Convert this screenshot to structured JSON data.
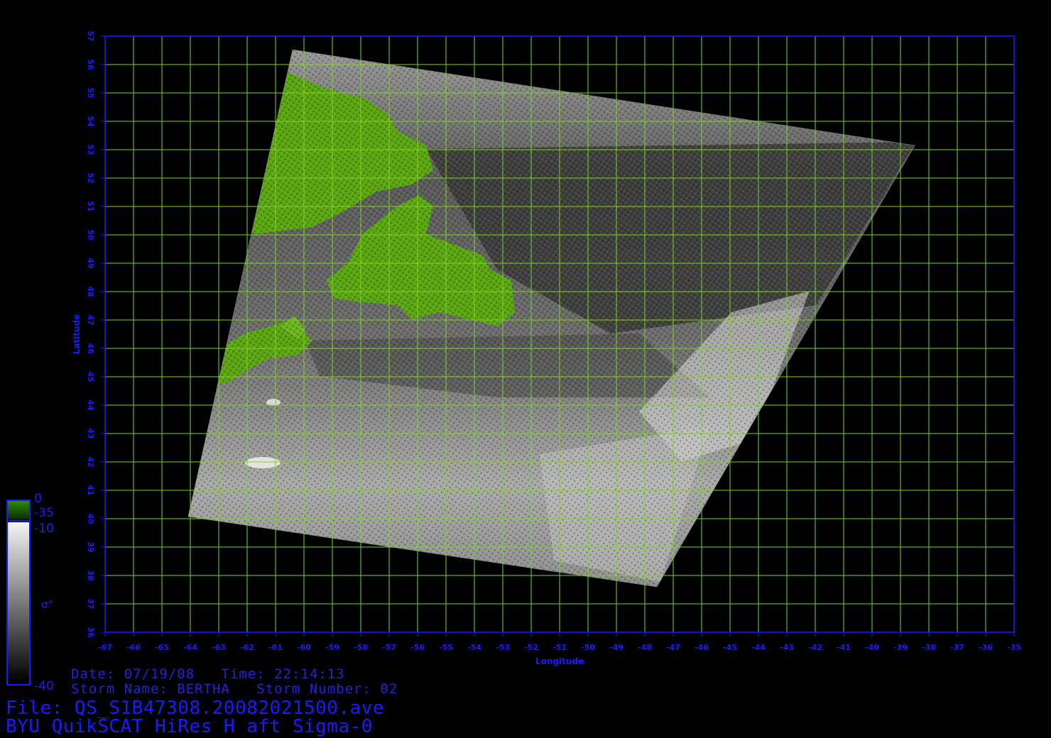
{
  "axes": {
    "xlabel": "Longitude",
    "ylabel": "Latitude",
    "lon_range": [
      -67,
      -35
    ],
    "lat_range": [
      36,
      57
    ],
    "lon_ticks": [
      -67,
      -66,
      -65,
      -64,
      -63,
      -62,
      -61,
      -60,
      -59,
      -58,
      -57,
      -56,
      -55,
      -54,
      -53,
      -52,
      -51,
      -50,
      -49,
      -48,
      -47,
      -46,
      -45,
      -44,
      -43,
      -42,
      -41,
      -40,
      -39,
      -38,
      -37,
      -36,
      -35
    ],
    "lat_ticks": [
      36,
      37,
      38,
      39,
      40,
      41,
      42,
      43,
      44,
      45,
      46,
      47,
      48,
      49,
      50,
      51,
      52,
      53,
      54,
      55,
      56,
      57
    ],
    "grid": true,
    "grid_color": "#7fd321",
    "axis_color": "#1a1aff"
  },
  "colorbar": {
    "land_top": "0",
    "land_bottom": "-35",
    "ocean_top": "-10",
    "ocean_bottom": "-40",
    "symbol": "σ°",
    "land_color": "#4c9a10",
    "ocean_colors": [
      "#f4f4f4",
      "#000000"
    ]
  },
  "info": {
    "date_line": "Date: 07/19/08   Time: 22:14:13",
    "storm_line": "Storm Name: BERTHA   Storm Number: 02",
    "file_line": "File: QS_S1B47308.20082021500.ave",
    "product_line": "BYU QuikSCAT HiRes H aft Sigma-0"
  },
  "image_colors": {
    "land": "#5aa512",
    "ocean_light": "#bdbdbd",
    "ocean_dark": "#2a2a2a"
  }
}
